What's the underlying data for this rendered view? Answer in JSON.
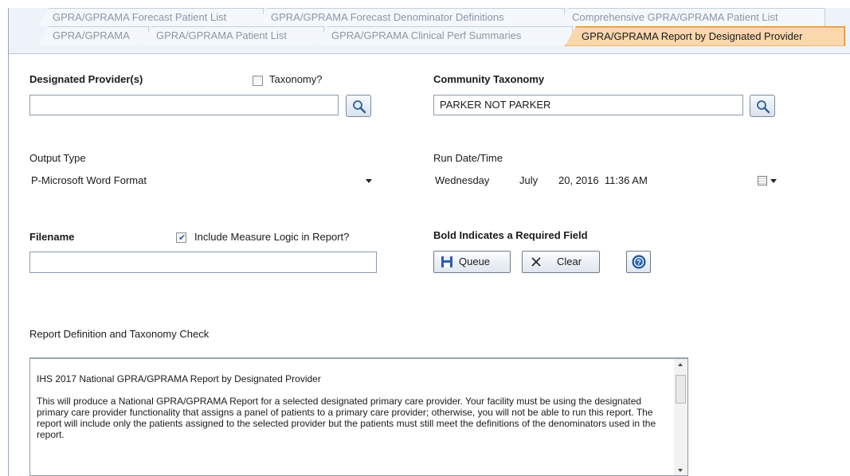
{
  "tabs": {
    "row1": [
      {
        "label": "GPRA/GPRAMA Forecast Patient List",
        "active": false
      },
      {
        "label": "GPRA/GPRAMA Forecast Denominator Definitions",
        "active": false
      },
      {
        "label": "Comprehensive GPRA/GPRAMA Patient List",
        "active": false
      }
    ],
    "row2": [
      {
        "label": "GPRA/GPRAMA",
        "active": false
      },
      {
        "label": "GPRA/GPRAMA Patient List",
        "active": false
      },
      {
        "label": "GPRA/GPRAMA Clinical Perf Summaries",
        "active": false
      },
      {
        "label": "GPRA/GPRAMA Report by Designated Provider",
        "active": true
      }
    ]
  },
  "form": {
    "designated_provider_label": "Designated Provider(s)",
    "designated_provider_value": "",
    "taxonomy_checkbox_label": "Taxonomy?",
    "taxonomy_checked": false,
    "community_taxonomy_label": "Community Taxonomy",
    "community_taxonomy_value": "PARKER NOT PARKER",
    "output_type_label": "Output Type",
    "output_type_value": "P-Microsoft Word Format",
    "run_datetime_label": "Run Date/Time",
    "run_day": "Wednesday",
    "run_month": "July",
    "run_date_rest": "20, 2016  11:36 AM",
    "filename_label": "Filename",
    "filename_value": "",
    "include_logic_label": "Include Measure Logic in Report?",
    "include_logic_checked": true,
    "required_note": "Bold Indicates a Required Field"
  },
  "buttons": {
    "queue": "Queue",
    "clear": "Clear"
  },
  "report": {
    "section_label": "Report Definition and Taxonomy Check",
    "title_line": "IHS 2017 National GPRA/GPRAMA Report by Designated Provider",
    "description": "This will produce a National GPRA/GPRAMA Report for a selected designated primary care provider.  Your facility must be using the designated primary care provider functionality that assigns a panel of patients to a primary care provider; otherwise, you will not be able to run this report.  The report will include only the patients assigned to the selected provider but the patients must still meet the definitions of the denominators used in the report."
  },
  "icons": {
    "lookup": "magnifier-icon",
    "calendar": "calendar-icon",
    "save": "floppy-disk-icon",
    "clear": "x-icon",
    "help": "help-icon"
  },
  "colors": {
    "active_tab_bg": "#fbd7ae",
    "active_tab_border": "#e08a2c",
    "tab_strip_bg": "#eef3f9"
  }
}
